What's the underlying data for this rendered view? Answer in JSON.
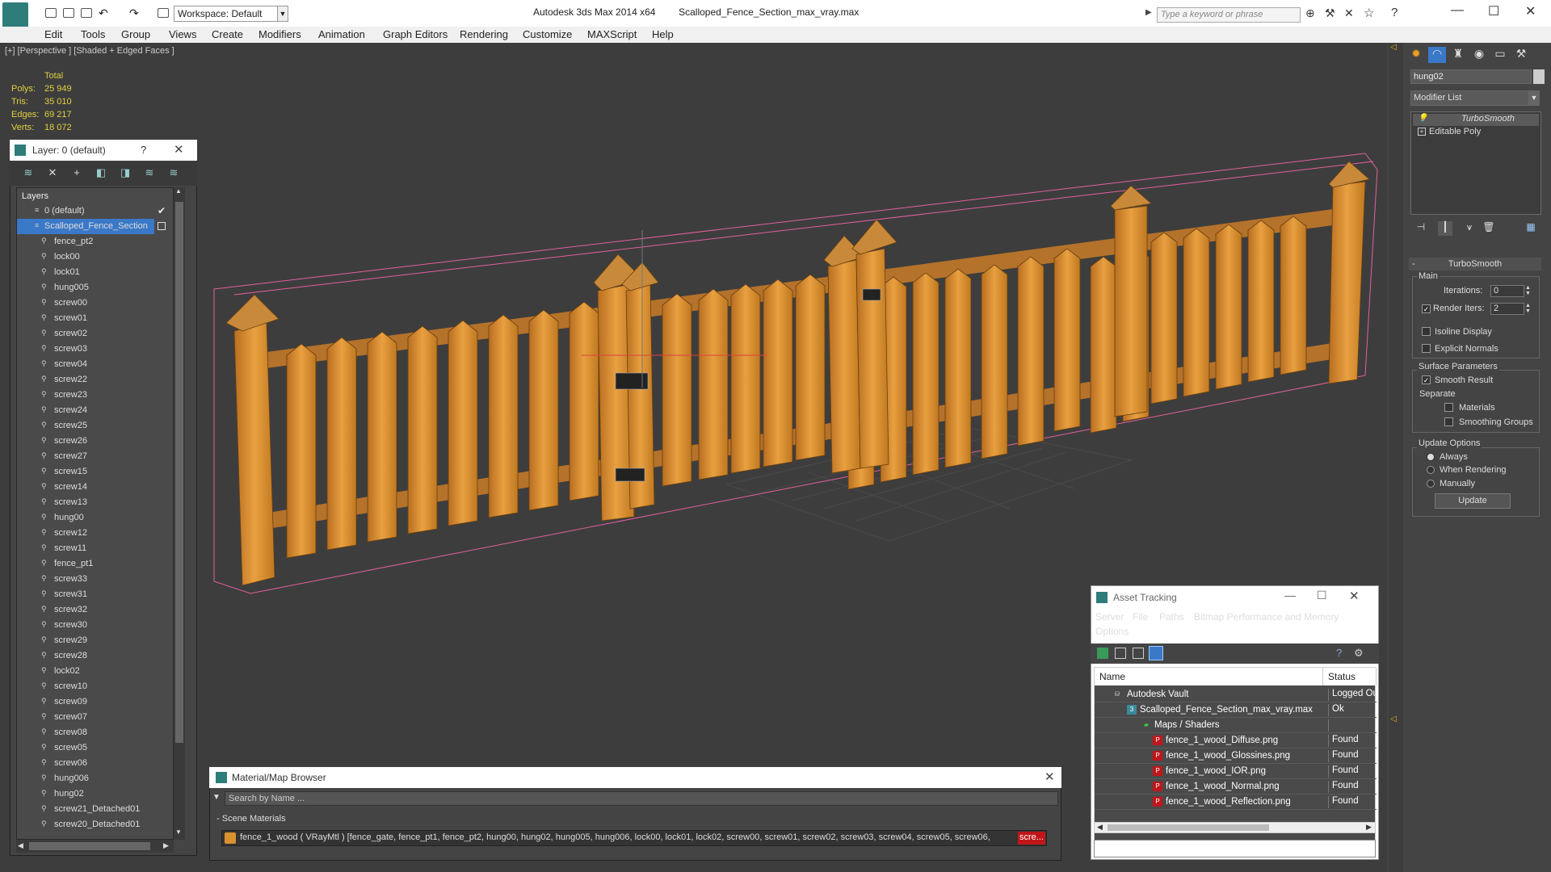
{
  "titlebar": {
    "workspace_label": "Workspace: Default",
    "app_name": "Autodesk 3ds Max  2014 x64",
    "file_name": "Scalloped_Fence_Section_max_vray.max",
    "search_placeholder": "Type a keyword or phrase"
  },
  "menu": [
    "Edit",
    "Tools",
    "Group",
    "Views",
    "Create",
    "Modifiers",
    "Animation",
    "Graph Editors",
    "Rendering",
    "Customize",
    "MAXScript",
    "Help"
  ],
  "viewport": {
    "label": "[+] [Perspective ] [Shaded + Edged Faces ]",
    "stats": {
      "header": "Total",
      "rows": [
        {
          "label": "Polys:",
          "value": "25 949"
        },
        {
          "label": "Tris:",
          "value": "35 010"
        },
        {
          "label": "Edges:",
          "value": "69 217"
        },
        {
          "label": "Verts:",
          "value": "18 072"
        }
      ]
    }
  },
  "layer_panel": {
    "title": "Layer: 0 (default)",
    "help": "?",
    "column_header": "Layers",
    "layers": [
      "0 (default)",
      "Scalloped_Fence_Section"
    ],
    "objects": [
      "fence_pt2",
      "lock00",
      "lock01",
      "hung005",
      "screw00",
      "screw01",
      "screw02",
      "screw03",
      "screw04",
      "screw22",
      "screw23",
      "screw24",
      "screw25",
      "screw26",
      "screw27",
      "screw15",
      "screw14",
      "screw13",
      "hung00",
      "screw12",
      "screw11",
      "fence_pt1",
      "screw33",
      "screw31",
      "screw32",
      "screw30",
      "screw29",
      "screw28",
      "lock02",
      "screw10",
      "screw09",
      "screw07",
      "screw08",
      "screw05",
      "screw06",
      "hung006",
      "hung02",
      "screw21_Detached01",
      "screw20_Detached01"
    ]
  },
  "material_browser": {
    "title": "Material/Map Browser",
    "search_placeholder": "Search by Name ...",
    "section": "Scene Materials",
    "material_row": "fence_1_wood  ( VRayMtl )  [fence_gate, fence_pt1, fence_pt2, hung00, hung02, hung005, hung006, lock00, lock01, lock02, screw00, screw01, screw02, screw03, screw04, screw05, screw06,",
    "material_row_tail": "scre..."
  },
  "asset_tracking": {
    "title": "Asset Tracking",
    "menu": [
      "Server",
      "File",
      "Paths",
      "Bitmap Performance and Memory",
      "Options"
    ],
    "columns": [
      "Name",
      "Status"
    ],
    "rows": [
      {
        "name": "Autodesk Vault",
        "status": "Logged Ou"
      },
      {
        "name": "Scalloped_Fence_Section_max_vray.max",
        "status": "Ok"
      },
      {
        "name": "Maps / Shaders",
        "status": ""
      },
      {
        "name": "fence_1_wood_Diffuse.png",
        "status": "Found"
      },
      {
        "name": "fence_1_wood_Glossines.png",
        "status": "Found"
      },
      {
        "name": "fence_1_wood_IOR.png",
        "status": "Found"
      },
      {
        "name": "fence_1_wood_Normal.png",
        "status": "Found"
      },
      {
        "name": "fence_1_wood_Reflection.png",
        "status": "Found"
      }
    ]
  },
  "command_panel": {
    "object_name": "hung02",
    "modifier_list": "Modifier List",
    "stack": [
      "TurboSmooth",
      "Editable Poly"
    ],
    "rollout_title": "TurboSmooth",
    "main_label": "Main",
    "iterations_label": "Iterations:",
    "iterations_value": "0",
    "render_iters_label": "Render Iters:",
    "render_iters_value": "2",
    "isoline_label": "Isoline Display",
    "explicit_normals_label": "Explicit Normals",
    "surface_params_label": "Surface Parameters",
    "smooth_result_label": "Smooth Result",
    "separate_label": "Separate",
    "materials_label": "Materials",
    "smoothing_groups_label": "Smoothing Groups",
    "update_options_label": "Update Options",
    "always_label": "Always",
    "when_rendering_label": "When Rendering",
    "manually_label": "Manually",
    "update_button": "Update"
  },
  "colors": {
    "wood": "#d9902e",
    "wood_dark": "#9a5a18",
    "viewport_bg": "#3d3d3d",
    "selection_pink": "#e060a0",
    "stats_yellow": "#e0d040",
    "layer_selected": "#3a78c8",
    "found_red": "#c0161a"
  }
}
